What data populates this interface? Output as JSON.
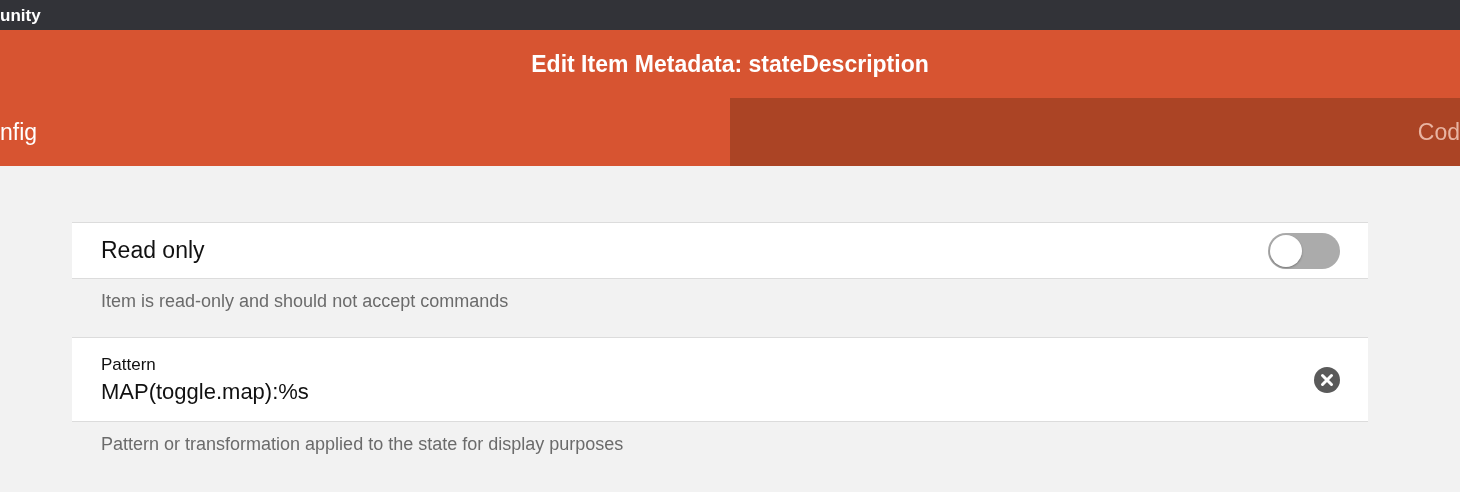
{
  "top_bar": {
    "title": "unity"
  },
  "dialog": {
    "title": "Edit Item Metadata: stateDescription"
  },
  "tabs": [
    {
      "label": "nfig",
      "selected": true
    },
    {
      "label": "Cod",
      "selected": false
    }
  ],
  "fields": [
    {
      "kind": "toggle",
      "label": "Read only",
      "on": false,
      "help": "Item is read-only and should not accept commands"
    },
    {
      "kind": "text",
      "label": "Pattern",
      "value": "MAP(toggle.map):%s",
      "help": "Pattern or transformation applied to the state for display purposes"
    }
  ]
}
